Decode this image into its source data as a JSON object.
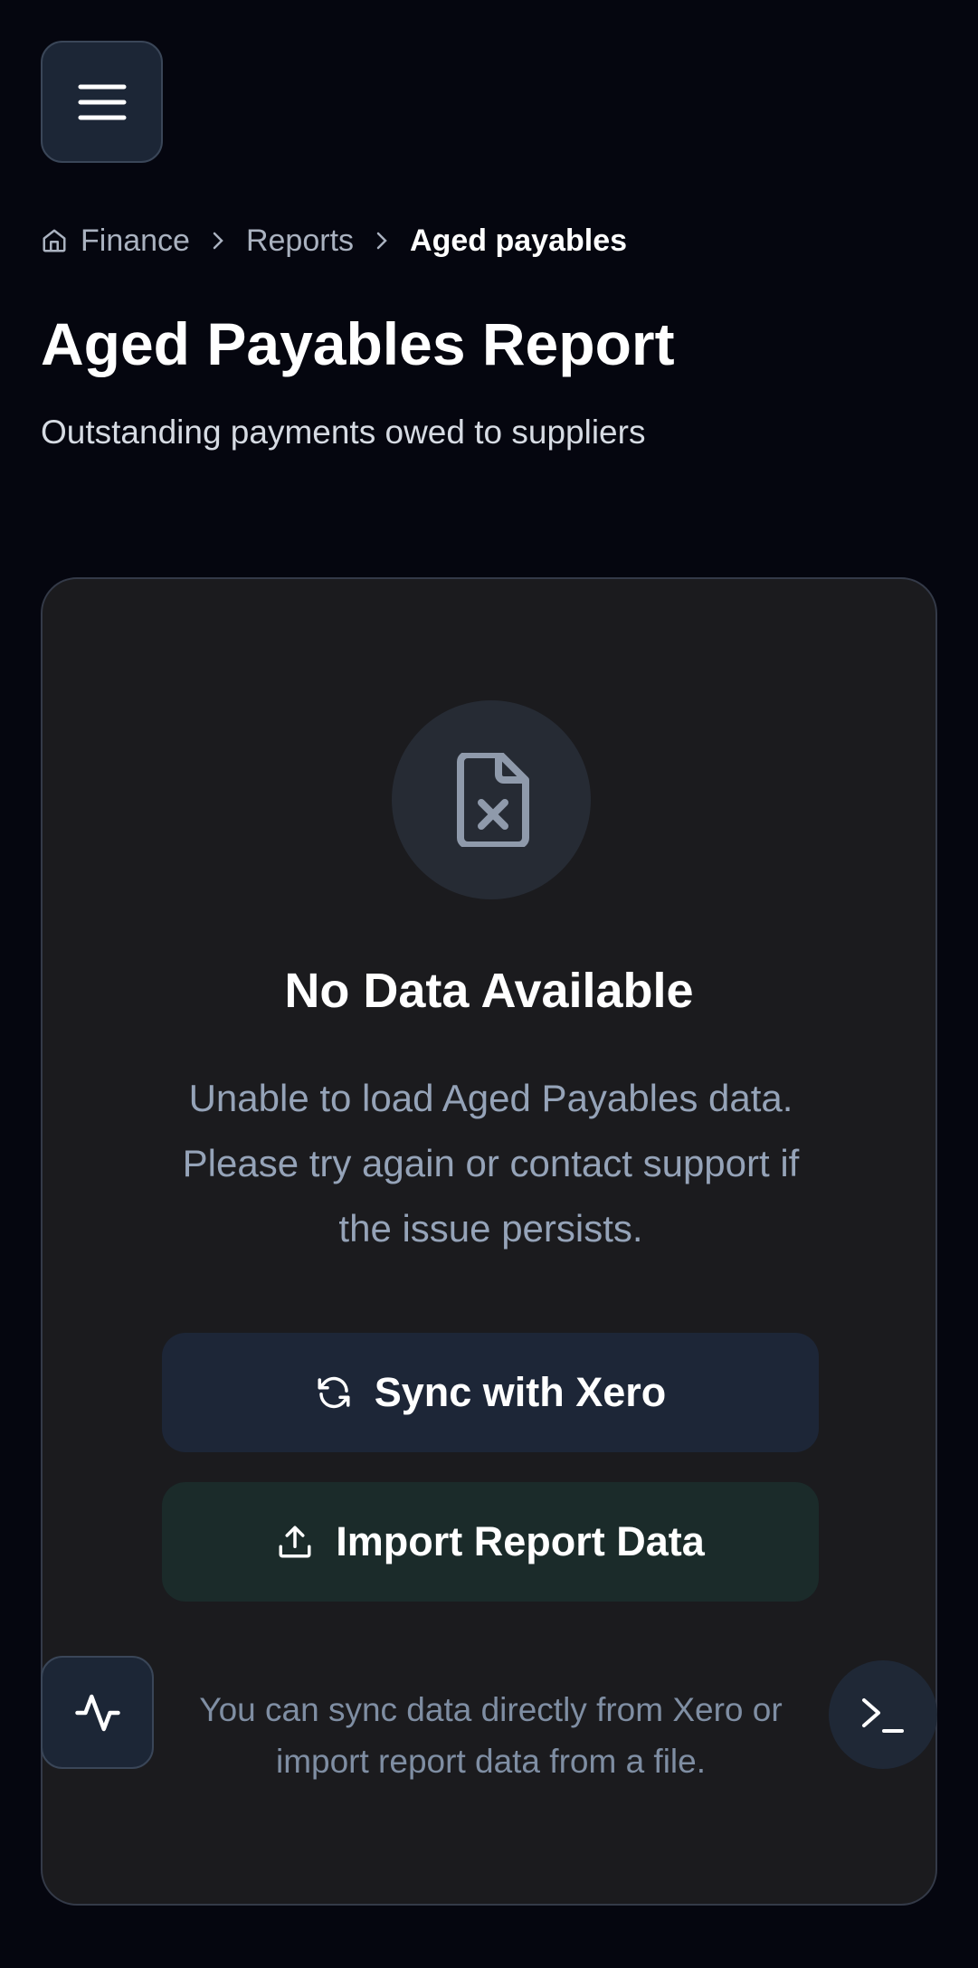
{
  "header": {
    "menu_icon": "hamburger-menu-icon"
  },
  "breadcrumb": {
    "home_icon": "home-icon",
    "items": [
      "Finance",
      "Reports",
      "Aged payables"
    ]
  },
  "page": {
    "title": "Aged Payables Report",
    "subtitle": "Outstanding payments owed to suppliers"
  },
  "empty_state": {
    "icon": "file-x-icon",
    "title": "No Data Available",
    "description": "Unable to load Aged Payables data. Please try again or contact support if the issue persists.",
    "sync_button": {
      "label": "Sync with Xero",
      "icon": "refresh-icon"
    },
    "import_button": {
      "label": "Import Report Data",
      "icon": "upload-icon"
    },
    "hint": "You can sync data directly from Xero or import report data from a file."
  },
  "floating": {
    "left_icon": "activity-icon",
    "right_icon": "terminal-icon"
  },
  "colors": {
    "background": "#05060f",
    "card": "#1b1b1e",
    "sync_button": "#1d2637",
    "import_button": "#1b2b2a",
    "muted_text": "#95a3b8"
  }
}
